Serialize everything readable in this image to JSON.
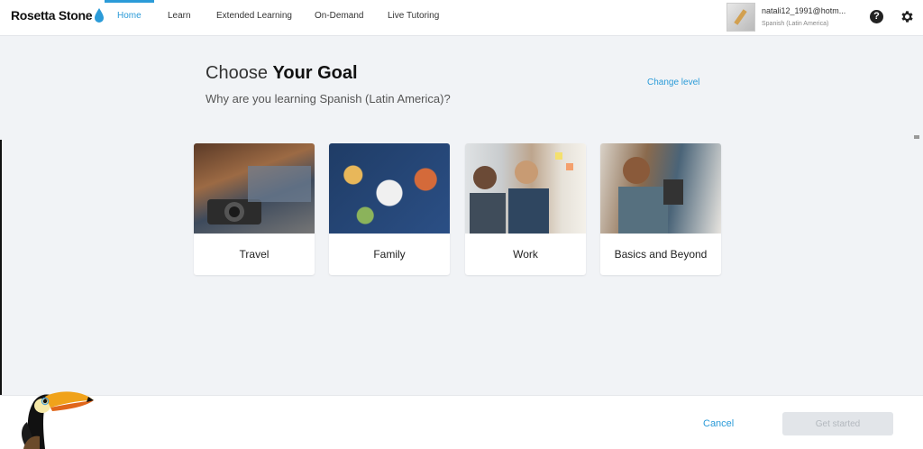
{
  "brand": {
    "name": "Rosetta Stone"
  },
  "nav": {
    "items": [
      {
        "label": "Home"
      },
      {
        "label": "Learn"
      },
      {
        "label": "Extended Learning"
      },
      {
        "label": "On-Demand"
      },
      {
        "label": "Live Tutoring"
      }
    ],
    "active": "Home"
  },
  "user": {
    "email": "natali12_1991@hotm...",
    "language": "Spanish (Latin America)"
  },
  "icons": {
    "help": "help-icon",
    "settings": "gear-icon",
    "mascot": "toucan-icon"
  },
  "page": {
    "heading_prefix": "Choose ",
    "heading_bold": "Your Goal",
    "subheading": "Why are you learning Spanish (Latin America)?",
    "change_level": "Change level"
  },
  "goals": [
    {
      "label": "Travel"
    },
    {
      "label": "Family"
    },
    {
      "label": "Work"
    },
    {
      "label": "Basics and Beyond"
    }
  ],
  "footer": {
    "cancel": "Cancel",
    "get_started": "Get started"
  },
  "colors": {
    "accent": "#2b9bd8",
    "background": "#f1f3f6",
    "disabled": "#e2e5e9"
  }
}
